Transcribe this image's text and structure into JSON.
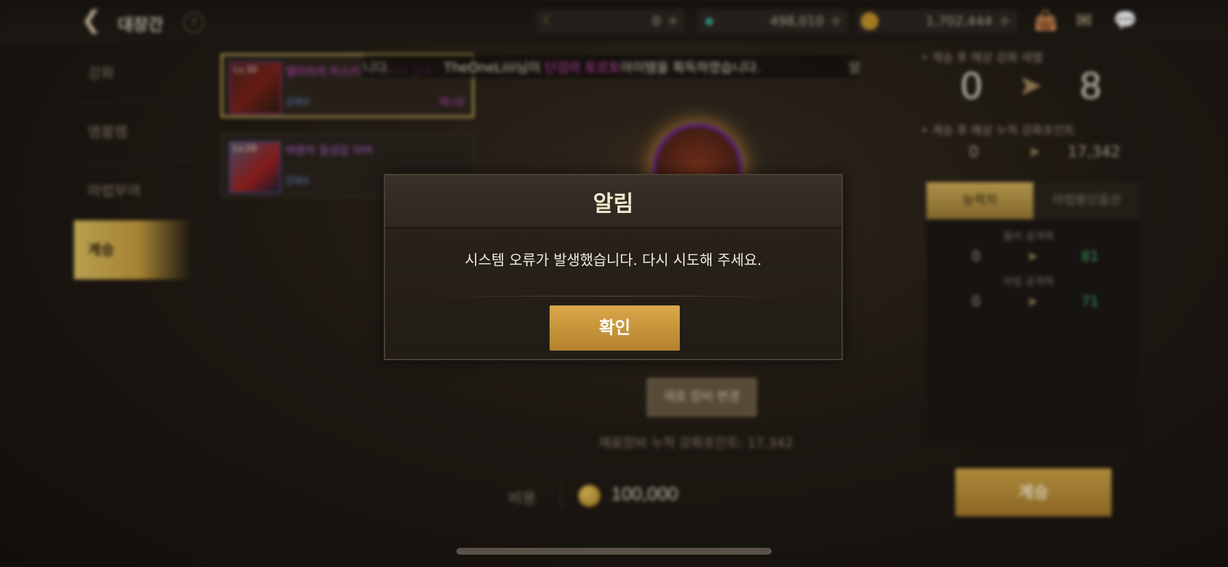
{
  "topbar": {
    "title": "대장간",
    "help": "?",
    "currencies": [
      {
        "icon": "crescent-icon",
        "value": "0"
      },
      {
        "icon": "crystal-icon",
        "value": "498,010"
      },
      {
        "icon": "gold-coin-icon",
        "value": "1,702,444"
      }
    ],
    "plus": "+"
  },
  "menu": {
    "items": [
      {
        "label": "강화"
      },
      {
        "label": "엠블렘"
      },
      {
        "label": "마법부여"
      },
      {
        "label": "계승"
      }
    ]
  },
  "items": [
    {
      "level": "Lv.30",
      "name": "텔미라의 허스키 ... 몬스터 집게",
      "sub": "강화0",
      "tag": "제나장"
    },
    {
      "level": "Lv.28",
      "name": "여명의 질성감 아머",
      "sub": "강화0"
    }
  ],
  "notice": {
    "left": "니다.",
    "player": "TheOneLiiii님이 ",
    "highlight": "단검의 토르토",
    "rest": "아이템을 획득하였습니다.",
    "right": "알"
  },
  "center": {
    "material_button": "재료 장비 변경",
    "material_points": "재료장비 누적 강화포인트: 17,342"
  },
  "right_panel": {
    "expected_level_label": "계승 후 예상 강화 레벨",
    "level_from": "0",
    "level_to": "8",
    "expected_points_label": "계승 후 예상 누적 강화포인트",
    "points_from": "0",
    "points_to": "17,342",
    "tabs": [
      "능력치",
      "마법봉인옵션"
    ],
    "stats": [
      {
        "label": "물리 공격력",
        "from": "0",
        "to": "81"
      },
      {
        "label": "마법 공격력",
        "from": "0",
        "to": "71"
      }
    ]
  },
  "cost": {
    "label": "비용",
    "value": "100,000"
  },
  "inherit_button": "계승",
  "dialog": {
    "title": "알림",
    "message": "시스템 오류가 발생했습니다. 다시 시도해 주세요.",
    "confirm": "확인"
  }
}
